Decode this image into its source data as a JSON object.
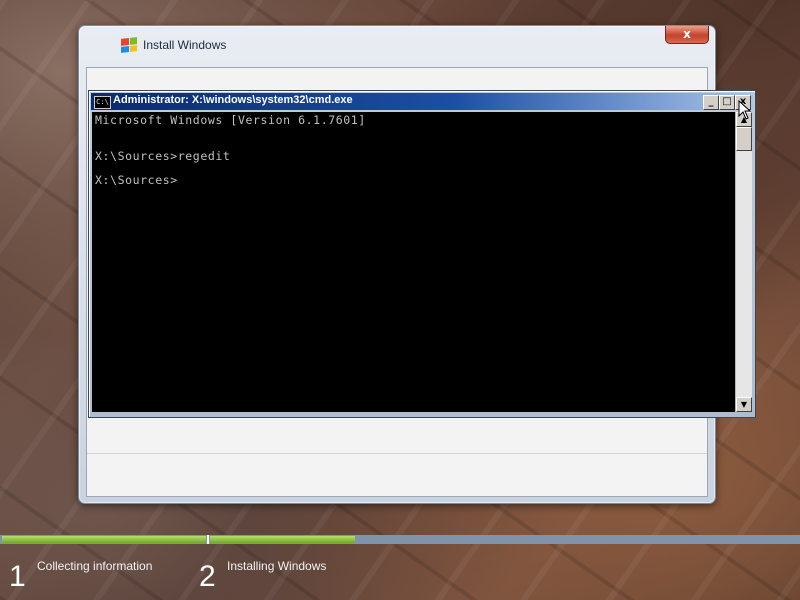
{
  "installer": {
    "title": "Install Windows",
    "close_label": "x"
  },
  "cmd": {
    "title": "Administrator: X:\\windows\\system32\\cmd.exe",
    "icon_text": "C:\\",
    "buttons": {
      "minimize": "_",
      "maximize": "□",
      "close": "x"
    },
    "lines": [
      "Microsoft Windows [Version 6.1.7601]",
      "",
      "X:\\Sources>regedit",
      "",
      "X:\\Sources>"
    ]
  },
  "progress": {
    "steps": [
      {
        "number": "1",
        "label": "Collecting information"
      },
      {
        "number": "2",
        "label": "Installing Windows"
      }
    ],
    "step1_fill": 1.0,
    "step2_fill": 0.33,
    "colors": {
      "fill": "#8cc63f",
      "track": "#7f93aa"
    }
  },
  "icons": [
    "windows-flag-icon",
    "cmd-icon",
    "minimize-icon",
    "maximize-icon",
    "close-icon",
    "scroll-up-icon",
    "scroll-down-icon",
    "mouse-cursor-icon"
  ]
}
